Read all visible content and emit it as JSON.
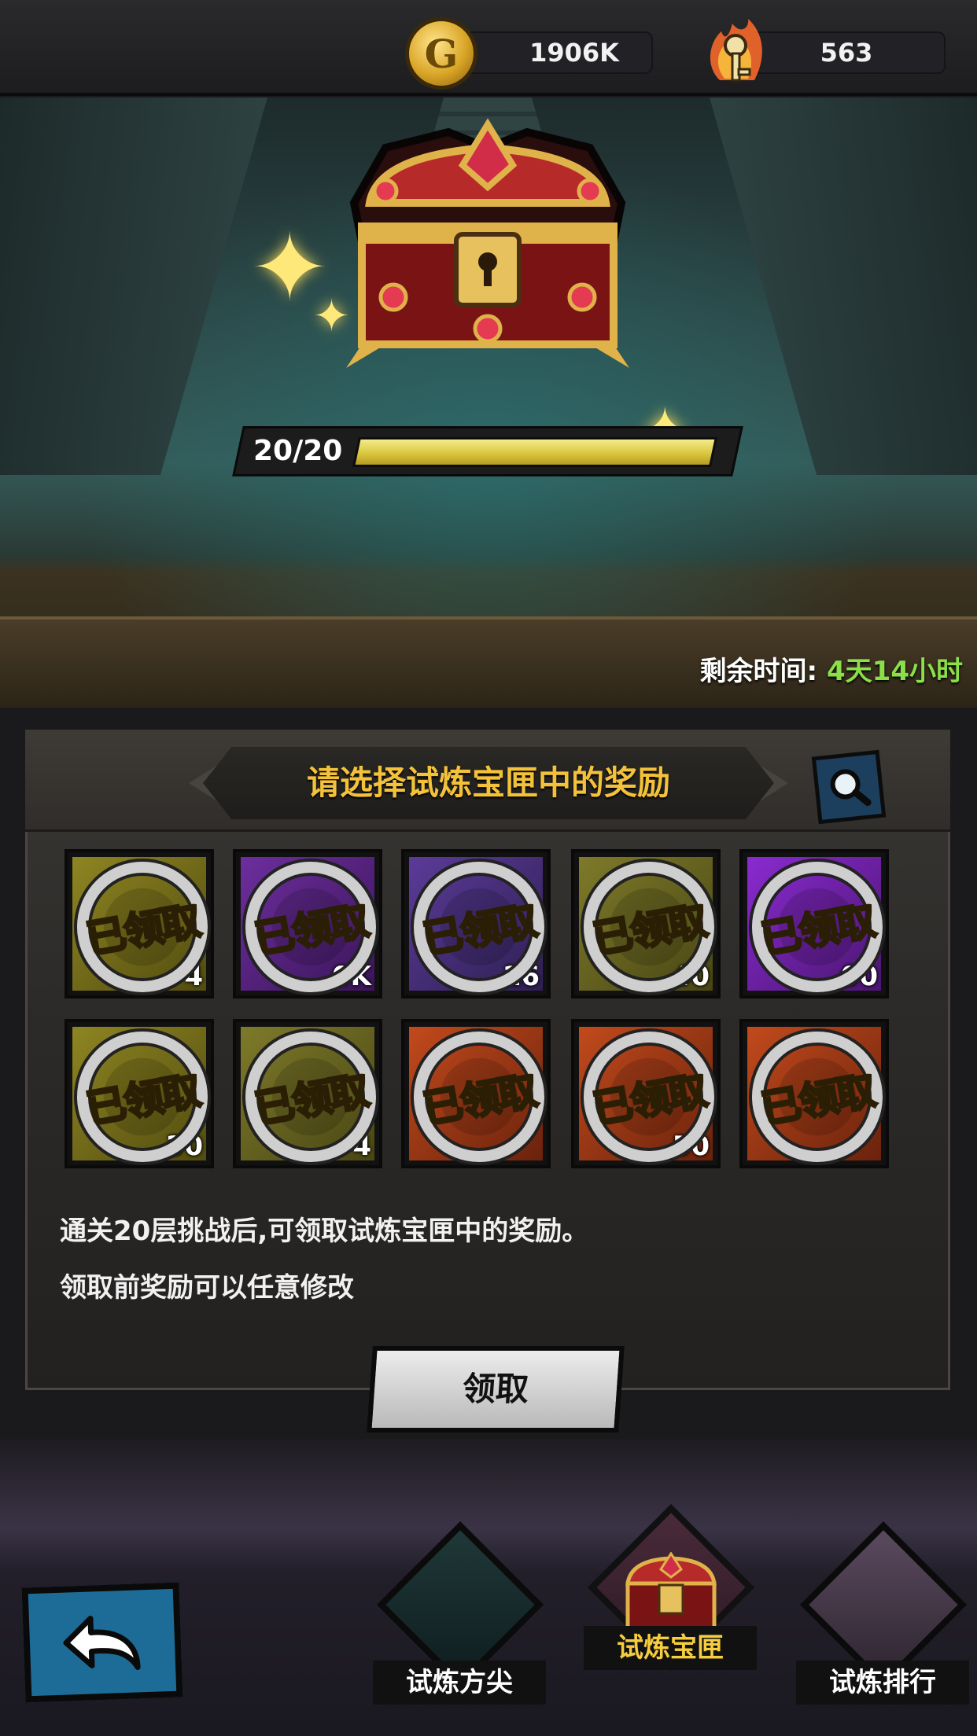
{
  "resources": {
    "gold": {
      "icon": "gold-coin-icon",
      "value": "1906K",
      "glyph": "G"
    },
    "keys": {
      "icon": "flaming-key-icon",
      "value": "563"
    }
  },
  "chest": {
    "progress_label": "20/20",
    "progress_fraction": 1.0,
    "remaining_label": "剩余时间:",
    "remaining_value": "4天14小时"
  },
  "panel": {
    "title": "请选择试炼宝匣中的奖励",
    "rewards": [
      {
        "frame": "gold",
        "amount": "4",
        "stamp": "已领取"
      },
      {
        "frame": "purple",
        "amount": "0K",
        "stamp": "已领取"
      },
      {
        "frame": "violet",
        "amount": "16",
        "stamp": "已领取"
      },
      {
        "frame": "olive",
        "amount": "40",
        "stamp": "已领取"
      },
      {
        "frame": "magenta",
        "amount": "00",
        "stamp": "已领取"
      },
      {
        "frame": "gold",
        "amount": "30",
        "stamp": "已领取"
      },
      {
        "frame": "olive",
        "amount": "4",
        "stamp": "已领取"
      },
      {
        "frame": "red",
        "amount": "",
        "stamp": "已领取"
      },
      {
        "frame": "red",
        "amount": "50",
        "stamp": "已领取"
      },
      {
        "frame": "red",
        "amount": "",
        "stamp": "已领取"
      }
    ],
    "desc_line1": "通关20层挑战后,可领取试炼宝匣中的奖励。",
    "desc_line2": "领取前奖励可以任意修改",
    "claim_label": "领取"
  },
  "nav": {
    "items": [
      {
        "label": "试炼方尖",
        "active": false
      },
      {
        "label": "试炼宝匣",
        "active": true
      },
      {
        "label": "试炼排行",
        "active": false
      }
    ]
  },
  "colors": {
    "accent_yellow": "#f3c23a",
    "time_green": "#8be04a"
  }
}
